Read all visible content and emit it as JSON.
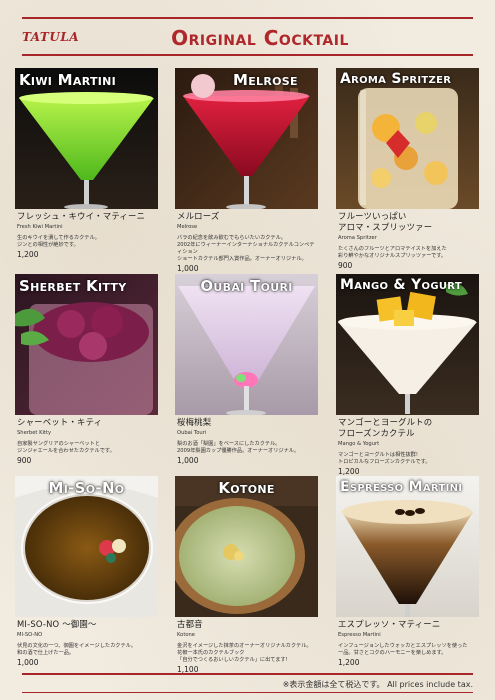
{
  "header": {
    "logo": "TATULA",
    "title": "Original Cocktail"
  },
  "items": [
    {
      "caption": "Kiwi Martini",
      "name_jp": "フレッシュ・キウイ・マティーニ",
      "name_en": "Fresh Kiwi Martini",
      "desc": [
        "生のキウイを潰して作るカクテル。",
        "ジンとの相性が絶妙です。"
      ],
      "price": "1,200"
    },
    {
      "caption": "Melrose",
      "name_jp": "メルローズ",
      "name_en": "Melrose",
      "desc": [
        "バラの紀念を飲み飲むでもらいたいカクテル。",
        "2002年にウィーナーインターナショナルカクテルコンペティション",
        "ショートカクテル部門入賞作品。オーナーオリジナル。"
      ],
      "price": "1,000"
    },
    {
      "caption": "Aroma Spritzer",
      "name_jp": "フルーツいっぱい",
      "name_jp2": "アロマ・スプリッツァー",
      "name_en": "Aroma Spritzer",
      "desc": [
        "たくさんのフルーツとアロマテイストを加えた",
        "彩り鮮やかなオリジナルスプリッツァーです。"
      ],
      "price": "900"
    },
    {
      "caption": "Sherbet Kitty",
      "name_jp": "シャーベット・キティ",
      "name_en": "Sherbet Kitty",
      "desc": [
        "自家製サングリアのシャーベットと",
        "ジンジャエールを合わせたカクテルです。"
      ],
      "price": "900"
    },
    {
      "caption": "Oubai Touri",
      "name_jp": "桜梅桃梨",
      "name_en": "Oubai Touri",
      "desc": [
        "梨のお酒「梨園」をベースにしたカクテル。",
        "2009年梨園カップ優勝作品。オーナーオリジナル。"
      ],
      "price": "1,000"
    },
    {
      "caption": "Mango & Yogurt",
      "name_jp": "マンゴーとヨーグルトの",
      "name_jp2": "フローズンカクテル",
      "name_en": "Mango & Yogurt",
      "desc": [
        "マンゴーとヨーグルトは相性抜群!",
        "トロピカルなフローズンカクテルです。"
      ],
      "price": "1,200"
    },
    {
      "caption": "Mi-So-No",
      "name_jp": "MI-SO-NO ～御園～",
      "name_en": "MI-SO-NO",
      "desc": [
        "伏見の文化の一つ、御園をイメージしたカクテル。",
        "和の酒で仕上げた一品。"
      ],
      "price": "1,000"
    },
    {
      "caption": "Kotone",
      "name_jp": "古都音",
      "name_en": "Kotone",
      "desc": [
        "金沢をイメージした抹茶のオーナーオリジナルカクテル。",
        "花椒一本氏のカクテルブック",
        "「自分でつくるおいしいカクテル」に出てます!"
      ],
      "price": "1,100"
    },
    {
      "caption": "Espresso Martini",
      "name_jp": "エスプレッソ・マティーニ",
      "name_en": "Espresso Martini",
      "desc": [
        "インフュージョンしたウォッカとエスプレッソを使った",
        "一品。甘さとコクのハーモニーを楽しめます。"
      ],
      "price": "1,200"
    }
  ],
  "footer": {
    "note": "※表示金額は全て税込です。  All prices include tax."
  },
  "colors": {
    "accent": "#a8262a",
    "paper": "#f1ebe0"
  }
}
